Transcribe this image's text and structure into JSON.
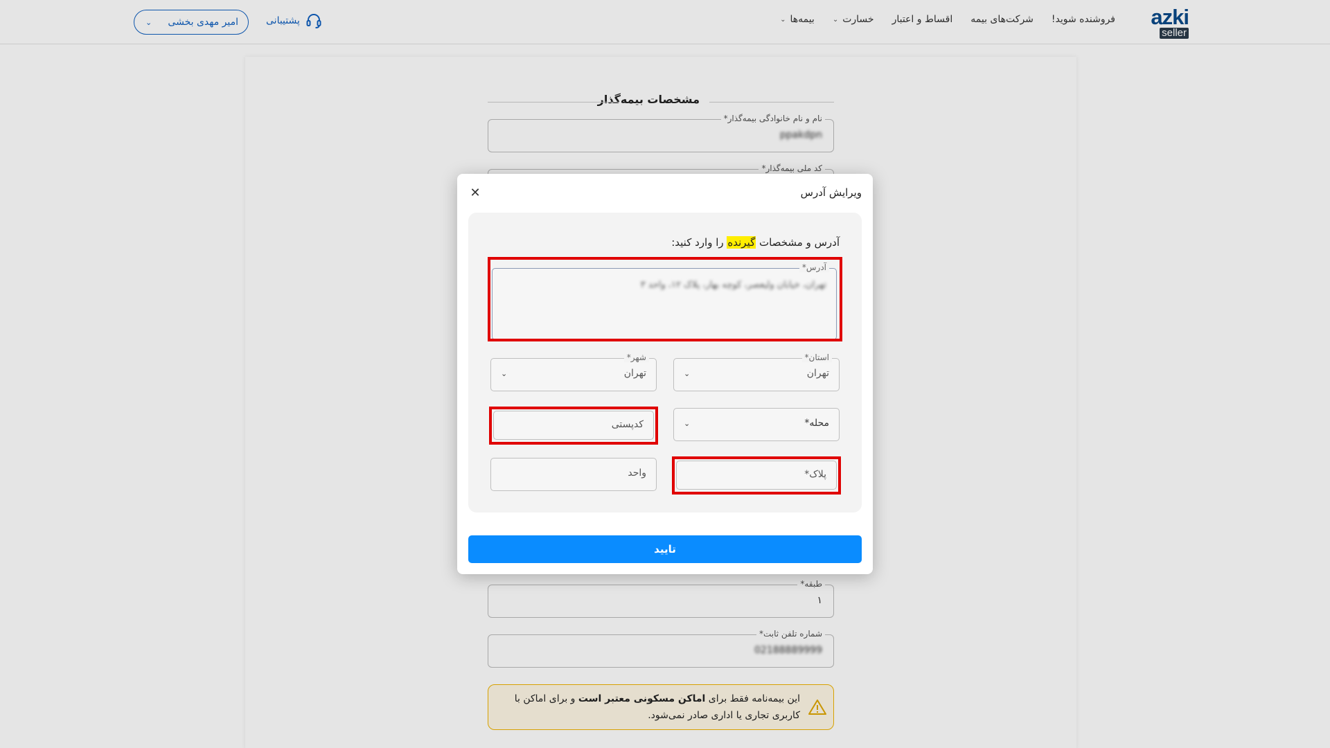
{
  "header": {
    "logo_top": "azki",
    "logo_bottom": "seller",
    "nav": [
      {
        "label": "بیمه‌ها",
        "has_dropdown": true
      },
      {
        "label": "خسارت",
        "has_dropdown": true
      },
      {
        "label": "اقساط و اعتبار",
        "has_dropdown": false
      },
      {
        "label": "شرکت‌های بیمه",
        "has_dropdown": false
      },
      {
        "label": "فروشنده شوید!",
        "has_dropdown": false
      }
    ],
    "support_label": "پشتیبانی",
    "user_name": "امیر مهدی بخشی"
  },
  "background_form": {
    "section_title": "مشخصات بیمه‌گذار",
    "fields": [
      {
        "label": "نام و نام خانوادگی بیمه‌گذار*",
        "value": "ppakdpn"
      },
      {
        "label": "کد ملی بیمه‌گذار*",
        "value": ""
      },
      {
        "label": "طبقه*",
        "value": "۱"
      },
      {
        "label": "شماره تلفن ثابت*",
        "value": "02188889999"
      }
    ],
    "alert": {
      "part1": "این بیمه‌نامه فقط برای ",
      "bold": "اماکن مسکونی معتبر است",
      "part2": " و برای اماکن با کاربری تجاری یا اداری صادر نمی‌شود."
    }
  },
  "modal": {
    "title": "ویرایش آدرس",
    "instruction_before": "آدرس و مشخصات ",
    "instruction_highlight": "گیرنده",
    "instruction_after": " را وارد کنید:",
    "address": {
      "label": "آدرس*",
      "value": "تهران، خیابان ولیعصر، کوچه بهار، پلاک ۱۲، واحد ۳"
    },
    "province": {
      "label": "استان*",
      "value": "تهران"
    },
    "city": {
      "label": "شهر*",
      "value": "تهران"
    },
    "district": {
      "placeholder": "محله*"
    },
    "postal_code": {
      "placeholder": "کدپستی"
    },
    "plaque": {
      "placeholder": "پلاک*"
    },
    "unit": {
      "placeholder": "واحد"
    },
    "confirm_label": "تایید"
  },
  "colors": {
    "primary": "#0a8cff",
    "highlight_box": "#e00000",
    "marker": "#ffee00",
    "brand": "#0b4a8a"
  }
}
